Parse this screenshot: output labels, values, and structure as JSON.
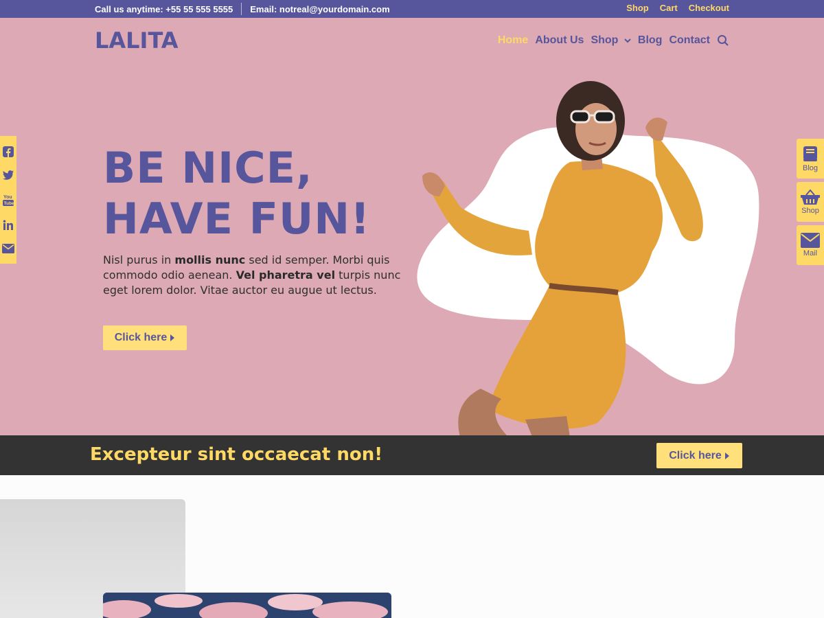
{
  "topbar": {
    "phone": "Call us anytime: +55 55 555 5555",
    "email": "Email: notreal@yourdomain.com",
    "links": [
      "Shop",
      "Cart",
      "Checkout"
    ]
  },
  "header": {
    "logo": "LALITA",
    "nav": [
      "Home",
      "About Us",
      "Shop",
      "Blog",
      "Contact"
    ]
  },
  "hero": {
    "line1": "BE NICE,",
    "line2": "HAVE FUN!",
    "p_a": "Nisl purus in ",
    "p_b": "mollis nunc",
    "p_c": " sed id semper. Morbi quis commodo odio aenean. ",
    "p_d": "Vel pharetra vel",
    "p_e": " turpis nunc eget lorem dolor. Vitae auctor eu augue ut lectus.",
    "button": "Click here"
  },
  "social": [
    "facebook-icon",
    "twitter-icon",
    "youtube-icon",
    "linkedin-icon",
    "mail-icon"
  ],
  "side_widgets": [
    "Blog",
    "Shop",
    "Mail"
  ],
  "banner": {
    "text": "Excepteur sint occaecat non!",
    "button": "Click here"
  },
  "colors": {
    "primary": "#57559b",
    "accent": "#ffd966",
    "hero_bg": "#dda9b4",
    "banner_bg": "#333333"
  }
}
